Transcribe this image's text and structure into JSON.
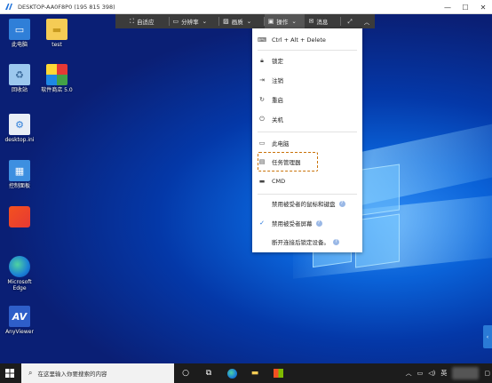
{
  "window": {
    "title": "DESKTOP-AA0F8P0 (195 815 398)",
    "controls": [
      "minimize",
      "maximize",
      "close"
    ]
  },
  "desktop_icons": [
    {
      "label": "此电脑",
      "icon": "computer-icon"
    },
    {
      "label": "test",
      "icon": "folder-icon"
    },
    {
      "label": "回收站",
      "icon": "recycle-bin-icon"
    },
    {
      "label": "软件商店 5.0",
      "icon": "store-icon"
    },
    {
      "label": "desktop.ini",
      "icon": "settings-file-icon"
    },
    {
      "label": "控制面板",
      "icon": "control-panel-icon"
    },
    {
      "label": "",
      "icon": "app-icon"
    },
    {
      "label": "Microsoft Edge",
      "icon": "edge-icon"
    },
    {
      "label": "AnyViewer",
      "icon": "anyviewer-icon"
    }
  ],
  "toolbar": {
    "items": [
      {
        "label": "自适应",
        "icon": "fit-icon"
      },
      {
        "label": "分辨率",
        "icon": "resolution-icon"
      },
      {
        "label": "画质",
        "icon": "image-quality-icon"
      },
      {
        "label": "操作",
        "icon": "operation-icon"
      },
      {
        "label": "消息",
        "icon": "message-icon"
      }
    ]
  },
  "menu": {
    "items": [
      {
        "label": "Ctrl + Alt + Delete",
        "icon": "keyboard-icon"
      },
      {
        "label": "锁定",
        "icon": "lock-icon"
      },
      {
        "label": "注销",
        "icon": "logout-icon"
      },
      {
        "label": "重启",
        "icon": "restart-icon"
      },
      {
        "label": "关机",
        "icon": "power-icon"
      },
      {
        "label": "此电脑",
        "icon": "monitor-icon"
      },
      {
        "label": "任务管理器",
        "icon": "task-manager-icon"
      },
      {
        "label": "CMD",
        "icon": "cmd-icon"
      },
      {
        "label": "禁用被受者的鼠标和键盘",
        "checked": false,
        "help": "?"
      },
      {
        "label": "禁用被受者屏幕",
        "checked": true,
        "help": "?"
      },
      {
        "label": "断开连接后锁定设备。",
        "checked": false,
        "help": "?"
      }
    ],
    "check_mark": "✓",
    "highlighted": "任务管理器"
  },
  "taskbar": {
    "search_placeholder": "在这里输入你要搜索的内容",
    "tray_ime": "英"
  },
  "colors": {
    "accent": "#1b6fd9",
    "highlight_border": "#c9730a",
    "toolbar_bg": "#3b3b3b"
  }
}
